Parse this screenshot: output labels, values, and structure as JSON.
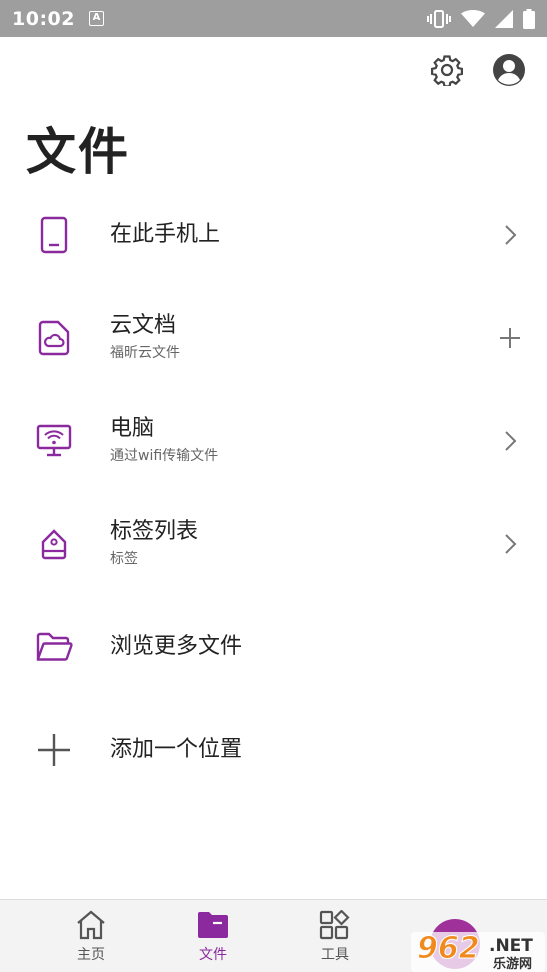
{
  "status": {
    "time": "10:02",
    "a_badge": "A"
  },
  "header": {
    "title": "文件"
  },
  "locations": [
    {
      "label": "在此手机上",
      "sub": "",
      "trail": "chevron-right-icon"
    },
    {
      "label": "云文档",
      "sub": "福昕云文件",
      "trail": "plus-icon"
    },
    {
      "label": "电脑",
      "sub": "通过wifi传输文件",
      "trail": "chevron-right-icon"
    },
    {
      "label": "标签列表",
      "sub": "标签",
      "trail": "chevron-right-icon"
    },
    {
      "label": "浏览更多文件",
      "sub": ""
    },
    {
      "label": "添加一个位置",
      "sub": ""
    }
  ],
  "nav": [
    {
      "label": "主页",
      "icon": "home-icon"
    },
    {
      "label": "文件",
      "icon": "folder-icon",
      "active": true
    },
    {
      "label": "工具",
      "icon": "tools-grid-icon"
    }
  ],
  "watermark": {
    "number": "962",
    "suffix": ".NET",
    "caption": "乐游网"
  },
  "colors": {
    "accent": "#8a2a9e",
    "status_bar": "#9e9e9e",
    "nav_bg": "#f3f3f3"
  }
}
